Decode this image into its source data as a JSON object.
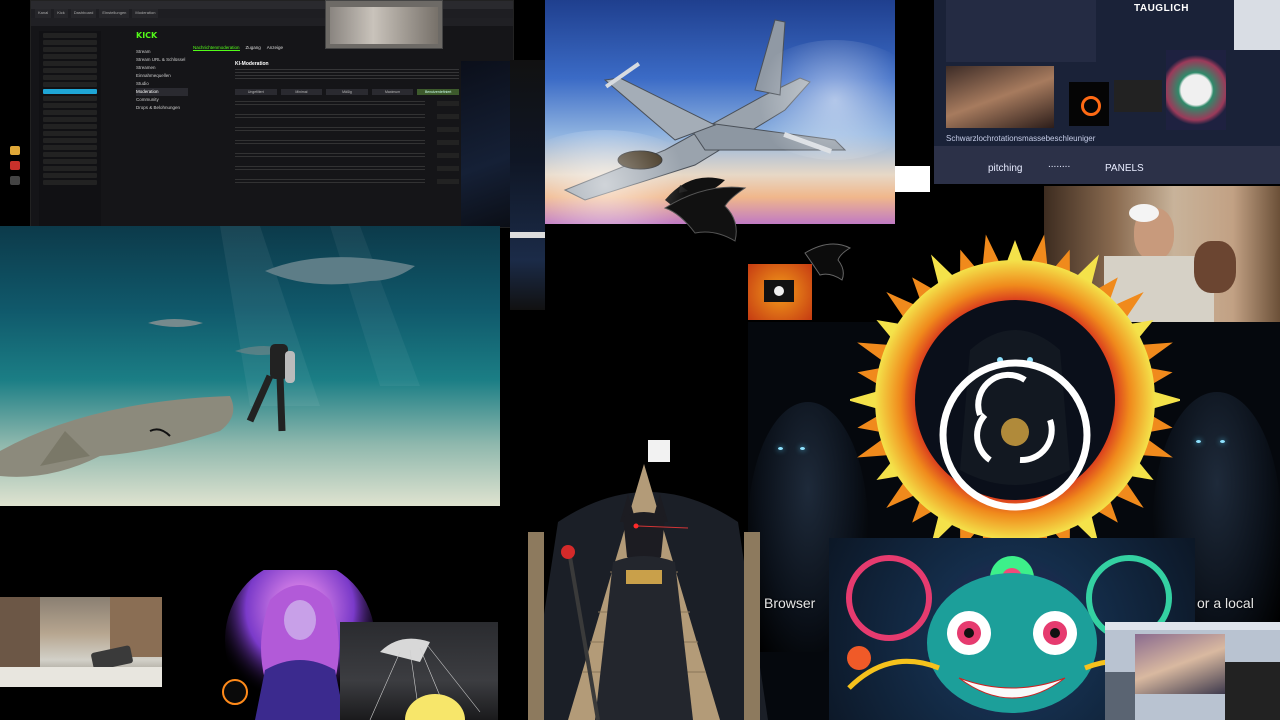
{
  "kick_window": {
    "tabs": [
      "Kanal",
      "Kick",
      "Dashboard",
      "Einstellungen",
      "Moderation"
    ],
    "logo": "KICK",
    "nav_items": [
      "Stream",
      "Stream URL & Schlüssel",
      "Streamen",
      "Einnahmequellen",
      "Studio",
      "Moderation",
      "Community",
      "Drops & Belohnungen"
    ],
    "main_tabs": [
      "Nachrichtenmoderation",
      "Zugang",
      "Anzeige"
    ],
    "section_title": "KI-Moderation",
    "level_labels": [
      "Ungefiltert",
      "Minimal",
      "Mäßig",
      "Maximum",
      "Benutzerdefiniert"
    ],
    "filter_rows": [
      "Sexuelle Inhalte",
      "Hassrede",
      "Gewalt",
      "Mobbing",
      "Drogen",
      "Waffen",
      "Spam"
    ]
  },
  "top_right_window": {
    "heading": "TAUGLICH",
    "caption": "Schwarzlochrotationsmassebeschleuniger",
    "bottom_left_label": "pitching",
    "bottom_right_label": "PANELS"
  },
  "hood_panel": {
    "left_text": "Browser",
    "right_text": "or a local"
  },
  "colors": {
    "kick_green": "#53fc18",
    "sun_red": "#d4281e",
    "sun_yellow": "#f4e24a",
    "obs_ring": "#ffffff"
  },
  "icons": {
    "obs": "obs-logo-icon",
    "pirate_flag": "pirate-flag-icon",
    "crow": "crow-icon"
  }
}
